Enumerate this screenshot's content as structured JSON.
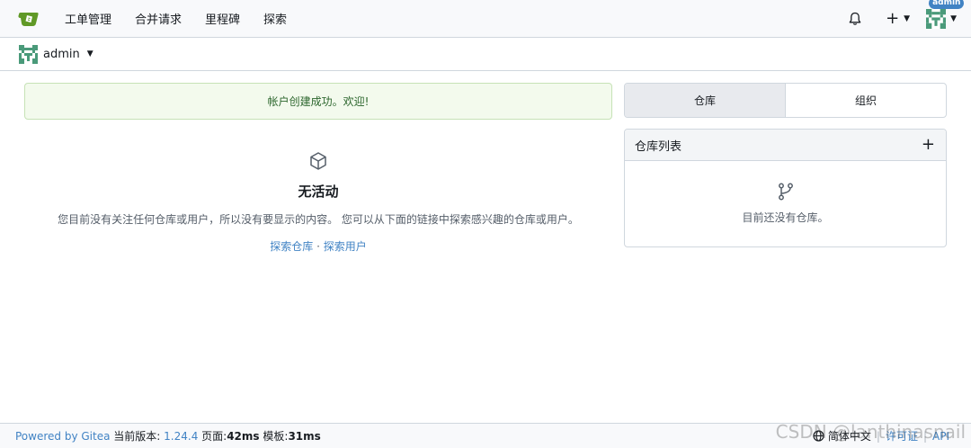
{
  "nav": {
    "items": [
      "工单管理",
      "合并请求",
      "里程碑",
      "探索"
    ],
    "plus_label": "+",
    "admin_badge": "admin"
  },
  "dashboard": {
    "context_user": "admin"
  },
  "flash": {
    "message": "帐户创建成功。欢迎!"
  },
  "feed": {
    "title": "无活动",
    "description": "您目前没有关注任何仓库或用户，所以没有要显示的内容。 您可以从下面的链接中探索感兴趣的仓库或用户。",
    "link_repos": "探索仓库",
    "link_sep": " · ",
    "link_users": "探索用户"
  },
  "right": {
    "tab_repos": "仓库",
    "tab_orgs": "组织",
    "repo_list_title": "仓库列表",
    "repo_add": "+",
    "repo_empty": "目前还没有仓库。"
  },
  "footer": {
    "powered": "Powered by Gitea",
    "version_label": "当前版本:",
    "version": "1.24.4",
    "page_label": "页面:",
    "page_time": "42ms",
    "tmpl_label": "模板:",
    "tmpl_time": "31ms",
    "language": "简体中文",
    "license": "许可证",
    "api": "API"
  },
  "watermark": "CSDN @lanthinasnail",
  "colors": {
    "accent": "#4183c4",
    "flash_bg": "#f3faed",
    "flash_text": "#2c662d",
    "logo": "#609926"
  }
}
